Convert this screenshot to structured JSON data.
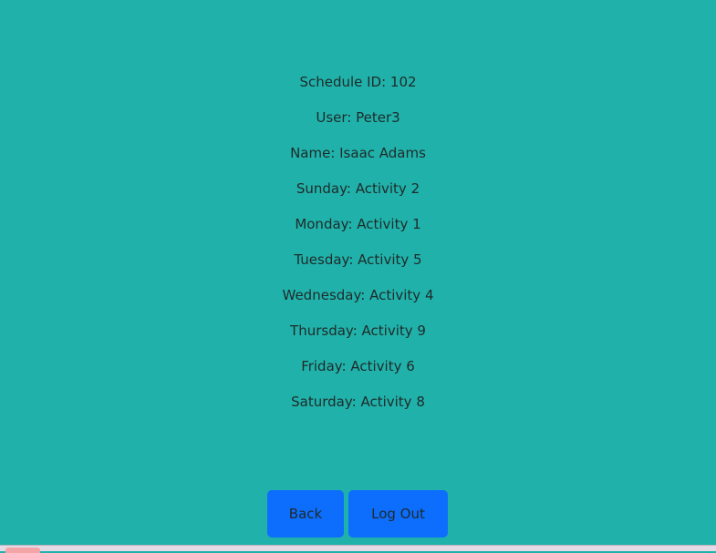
{
  "schedule": {
    "id_line": "Schedule ID: 102",
    "user_line": "User: Peter3",
    "name_line": "Name: Isaac Adams",
    "days": [
      "Sunday: Activity 2",
      "Monday: Activity 1",
      "Tuesday: Activity 5",
      "Wednesday: Activity 4",
      "Thursday: Activity 9",
      "Friday: Activity 6",
      "Saturday: Activity 8"
    ]
  },
  "buttons": {
    "back_label": "Back",
    "logout_label": "Log Out"
  },
  "colors": {
    "background": "#20b2aa",
    "button": "#0d6efd",
    "text": "#1f2a2a"
  }
}
